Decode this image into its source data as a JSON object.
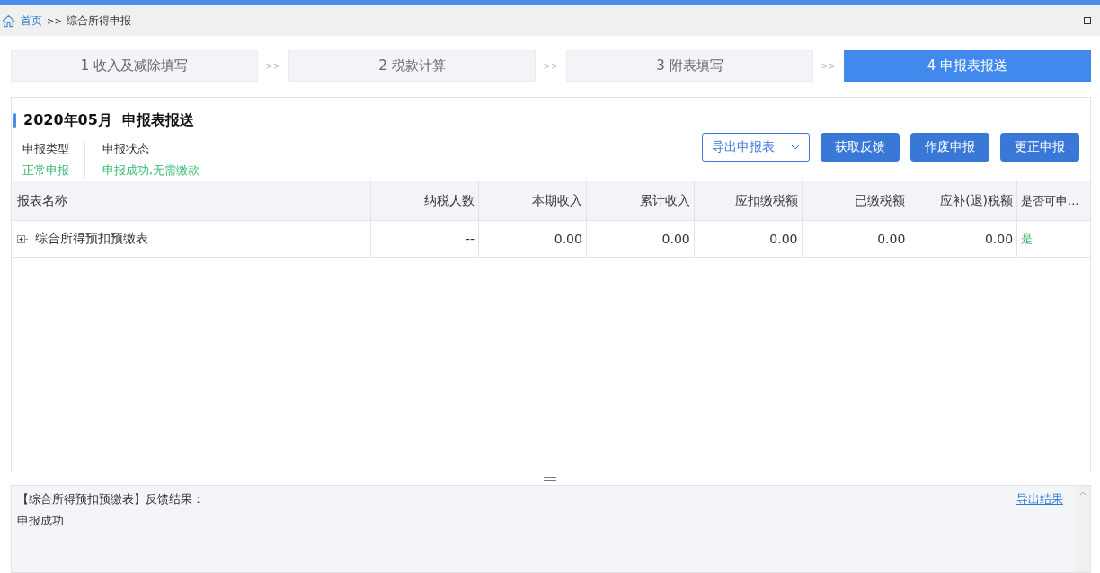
{
  "breadcrumb": {
    "home": "首页",
    "separator": ">>",
    "current": "综合所得申报"
  },
  "steps": [
    {
      "label": "1 收入及减除填写",
      "selected": false
    },
    {
      "label": "2 税款计算",
      "selected": false
    },
    {
      "label": "3 附表填写",
      "selected": false
    },
    {
      "label": "4 申报表报送",
      "selected": true
    }
  ],
  "step_separator": ">>",
  "panel": {
    "period": "2020年05月",
    "title": "申报表报送",
    "info": [
      {
        "label": "申报类型",
        "value": "正常申报"
      },
      {
        "label": "申报状态",
        "value": "申报成功,无需缴款"
      }
    ],
    "export_dropdown": "导出申报表",
    "buttons": [
      "获取反馈",
      "作废申报",
      "更正申报"
    ]
  },
  "table": {
    "columns": [
      "报表名称",
      "纳税人数",
      "本期收入",
      "累计收入",
      "应扣缴税额",
      "已缴税额",
      "应补(退)税额",
      "是否可申..."
    ],
    "rows": [
      {
        "expanded": false,
        "cells": [
          "综合所得预扣预缴表",
          "--",
          "0.00",
          "0.00",
          "0.00",
          "0.00",
          "0.00",
          "是"
        ]
      }
    ]
  },
  "feedback": {
    "heading": "【综合所得预扣预缴表】反馈结果：",
    "message": "申报成功",
    "export_link": "导出结果"
  }
}
